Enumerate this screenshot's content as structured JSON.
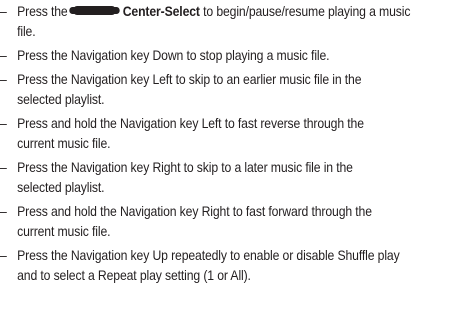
{
  "items": [
    {
      "dash": "–",
      "pre": "Press the",
      "icon": "center-select-key-icon",
      "bold": "Center-Select",
      "post": "to begin/pause/resume playing a music",
      "cont": "file."
    },
    {
      "dash": "–",
      "text": "Press the Navigation key Down to stop playing a music file."
    },
    {
      "dash": "–",
      "text": "Press the Navigation key Left to skip to an earlier music file in the",
      "cont": "selected playlist."
    },
    {
      "dash": "–",
      "text": "Press and hold the Navigation key Left to fast reverse through the",
      "cont": "current music file."
    },
    {
      "dash": "–",
      "text": "Press the Navigation key Right to skip to a later music file in the",
      "cont": "selected playlist."
    },
    {
      "dash": "–",
      "text": "Press and hold the Navigation key Right to fast forward through the",
      "cont": "current music file."
    },
    {
      "dash": "–",
      "text": "Press the Navigation key Up repeatedly to enable or disable Shuffle play",
      "cont": "and to select a Repeat play setting (1 or All)."
    }
  ]
}
